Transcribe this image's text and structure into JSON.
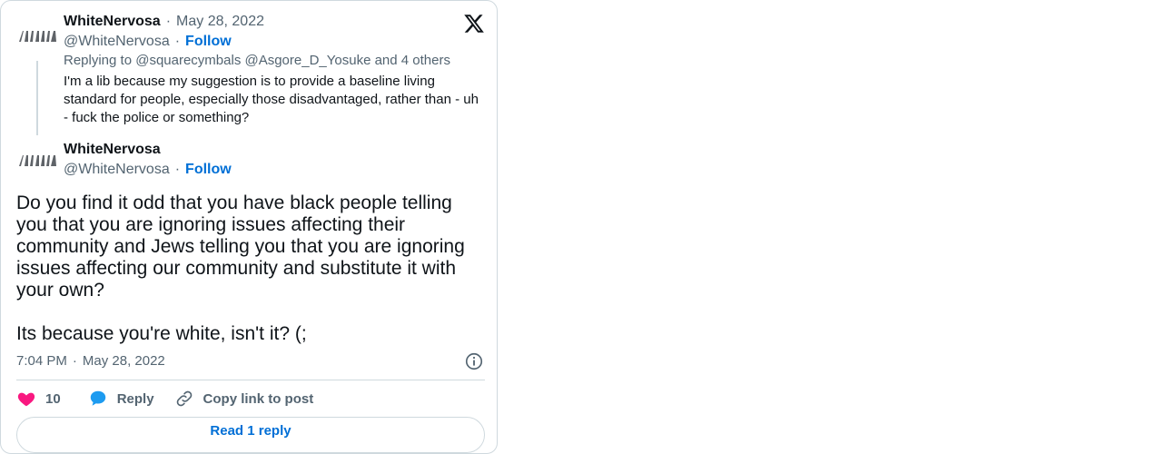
{
  "parent_tweet": {
    "display_name": "WhiteNervosa",
    "date": "May 28, 2022",
    "handle": "@WhiteNervosa",
    "follow_label": "Follow",
    "replying_to": "Replying to @squarecymbals @Asgore_D_Yosuke and 4 others",
    "text": "I'm a lib because my suggestion is to provide a baseline living standard for people, especially those disadvantaged, rather than - uh - fuck the police or something?"
  },
  "main_tweet": {
    "display_name": "WhiteNervosa",
    "handle": "@WhiteNervosa",
    "follow_label": "Follow",
    "text": "Do you find it odd that you have black people telling you that you are ignoring issues affecting their community and Jews telling you that you are ignoring issues affecting our community and substitute it with your own?\n\nIts because you're white, isn't it? (;",
    "time": "7:04 PM",
    "date": "May 28, 2022"
  },
  "actions": {
    "likes_count": "10",
    "reply_label": "Reply",
    "copy_link_label": "Copy link to post"
  },
  "read_replies_label": "Read 1 reply",
  "separator": "·",
  "icons": {
    "logo": "x-logo-icon",
    "info": "info-icon",
    "like": "heart-icon",
    "reply": "speech-bubble-icon",
    "copy": "link-icon"
  },
  "colors": {
    "link_blue": "#006fd6",
    "like_pink": "#f91880",
    "reply_blue": "#1d9bf0",
    "muted": "#536471",
    "border": "#cfd9de"
  }
}
